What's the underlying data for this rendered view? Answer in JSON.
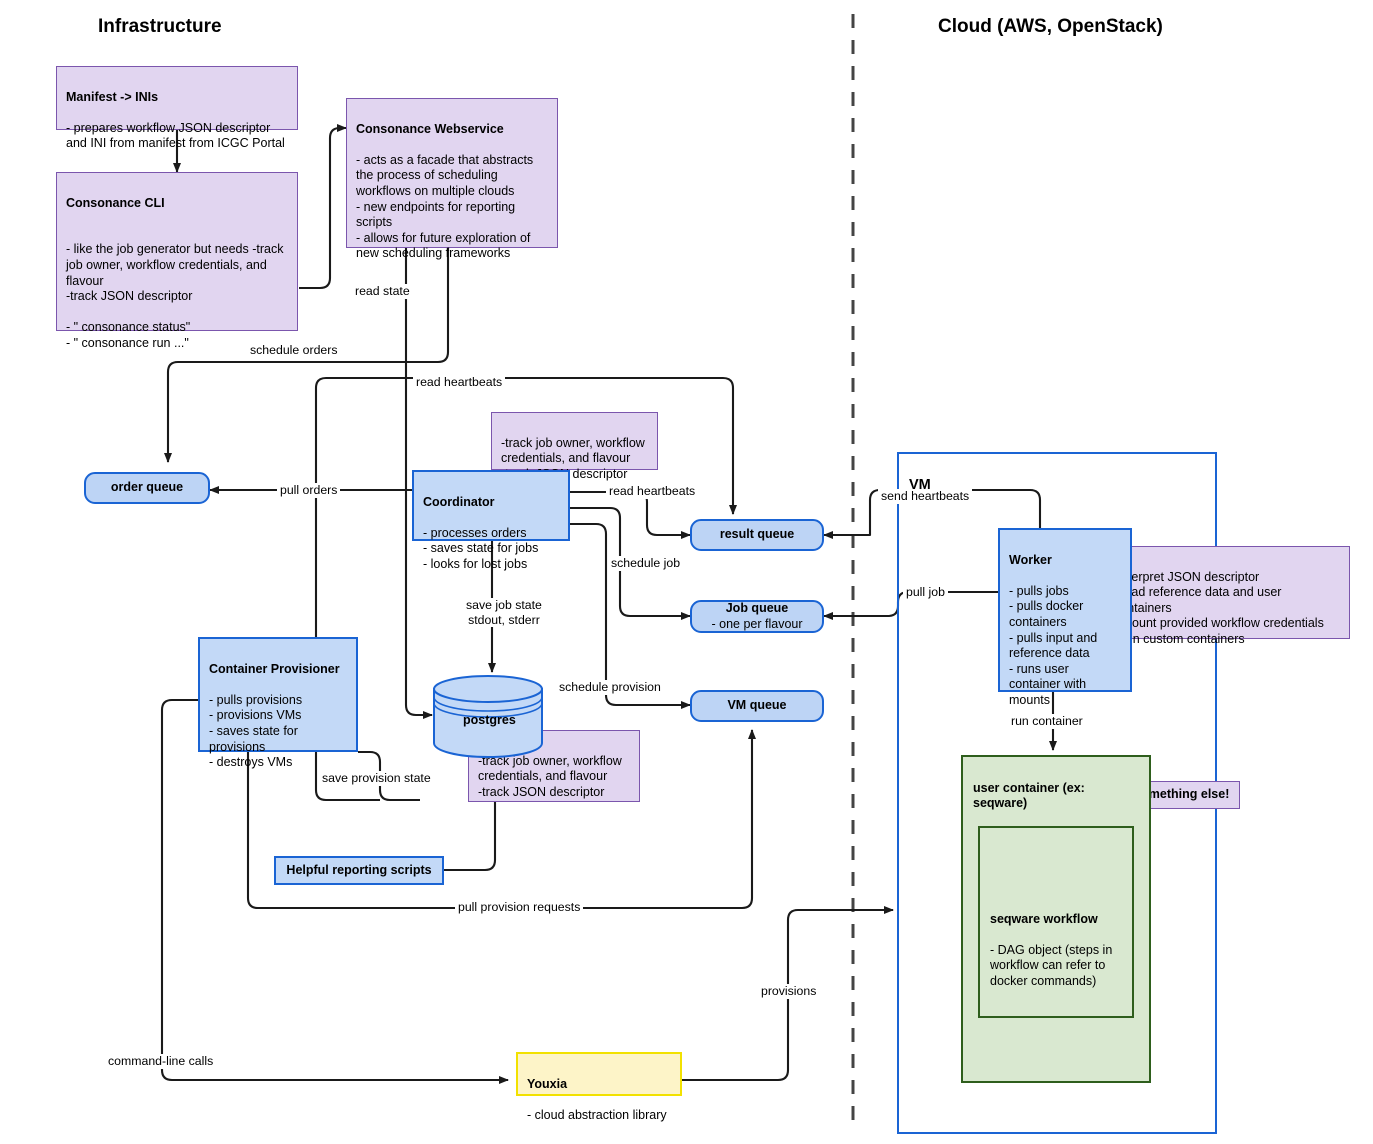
{
  "diagram": {
    "sections": {
      "left_title": "Infrastructure",
      "right_title": "Cloud (AWS, OpenStack)"
    },
    "nodes": {
      "manifest": {
        "title": "Manifest -> INIs",
        "body": "- prepares workflow JSON descriptor and INI from manifest from ICGC Portal"
      },
      "consonance_cli": {
        "title": "Consonance CLI",
        "body": "\n- like the job generator but needs -track job owner, workflow credentials, and flavour\n-track JSON descriptor\n\n- \" consonance status\"\n- \" consonance run ...\""
      },
      "consonance_webservice": {
        "title": "Consonance Webservice",
        "body": "- acts as a facade that abstracts the process of scheduling workflows on multiple clouds\n- new endpoints for reporting scripts\n- allows for future exploration of new scheduling frameworks"
      },
      "coordinator_note": {
        "title": "",
        "body": "-track job owner, workflow credentials, and flavour\n-track JSON descriptor"
      },
      "coordinator": {
        "title": "Coordinator",
        "body": "- processes orders\n- saves state for jobs\n- looks for lost jobs"
      },
      "order_queue": {
        "title": "order queue",
        "body": ""
      },
      "result_queue": {
        "title": "result queue",
        "body": ""
      },
      "job_queue": {
        "title": "Job queue",
        "body": "- one per flavour"
      },
      "vm_queue": {
        "title": "VM queue",
        "body": ""
      },
      "container_provisioner": {
        "title": "Container Provisioner",
        "body": "- pulls provisions\n- provisions VMs\n- saves state for provisions\n- destroys VMs"
      },
      "postgres": {
        "label": "postgres"
      },
      "postgres_note": {
        "title": "",
        "body": "-track job owner, workflow credentials, and flavour\n-track JSON descriptor"
      },
      "reporting_scripts": {
        "title": "Helpful reporting scripts",
        "body": ""
      },
      "youxia": {
        "title": "Youxia",
        "body": "- cloud abstraction library"
      },
      "vm": {
        "title": "VM"
      },
      "worker": {
        "title": "Worker",
        "body": "- pulls jobs\n- pulls docker containers\n- pulls input and reference data\n- runs user container with mounts"
      },
      "worker_note": {
        "title": "",
        "body": "-interpret JSON descriptor\n- load reference data and user containers\n- mount provided workflow credentials\n- run custom containers"
      },
      "user_container": {
        "title": "user container (ex: seqware)",
        "body": ""
      },
      "something_else": {
        "title": "- or something else!",
        "body": ""
      },
      "seqware_workflow": {
        "title": "seqware workflow",
        "body": "- DAG object (steps in workflow can refer to docker commands)"
      }
    },
    "edge_labels": {
      "read_state": "read state",
      "schedule_orders": "schedule orders",
      "read_heartbeats_left": "read heartbeats",
      "pull_orders": "pull orders",
      "read_heartbeats_right": "read heartbeats",
      "schedule_job": "schedule job",
      "save_job_state": "save job state\nstdout, stderr",
      "schedule_provision": "schedule provision",
      "save_provision_state": "save provision state",
      "pull_provision_requests": "pull provision requests",
      "command_line_calls": "command-line calls",
      "provisions": "provisions",
      "send_heartbeats": "send heartbeats",
      "pull_job": "pull job",
      "run_container": "run container"
    },
    "colors": {
      "purple_fill": "#e1d5f0",
      "purple_border": "#7b56ad",
      "blue_fill": "#c3d9f7",
      "blue_border": "#1a64d4",
      "queue_fill": "#bdd4f5",
      "yellow_fill": "#fdf4c8",
      "yellow_border": "#f2e100",
      "green_fill": "#d9e8d0",
      "green_border": "#2e5e1c",
      "edge": "#1a1a1a"
    }
  }
}
